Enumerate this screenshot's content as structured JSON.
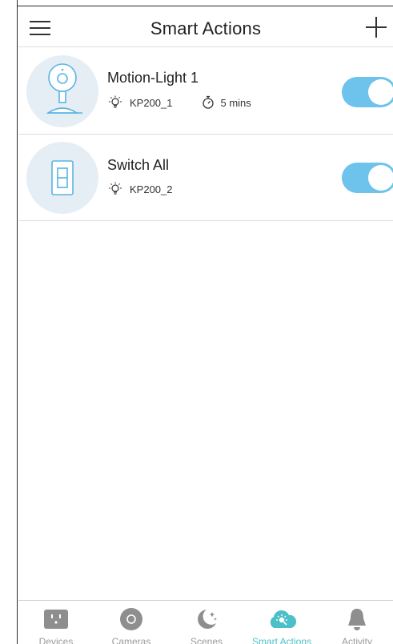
{
  "header": {
    "title": "Smart Actions",
    "menu_icon": "hamburger-menu-icon",
    "add_icon": "plus-icon"
  },
  "actions": [
    {
      "name": "Motion-Light 1",
      "device_icon": "camera-icon",
      "trigger_icon": "light-bulb-icon",
      "device": "KP200_1",
      "timer_icon": "stopwatch-icon",
      "duration": "5 mins",
      "enabled": true
    },
    {
      "name": "Switch All",
      "device_icon": "light-switch-icon",
      "trigger_icon": "light-bulb-icon",
      "device": "KP200_2",
      "enabled": true
    }
  ],
  "tabs": [
    {
      "label": "Devices",
      "icon": "outlet-icon",
      "active": false
    },
    {
      "label": "Cameras",
      "icon": "camera-lens-icon",
      "active": false
    },
    {
      "label": "Scenes",
      "icon": "moon-stars-icon",
      "active": false
    },
    {
      "label": "Smart Actions",
      "icon": "smart-actions-cloud-icon",
      "active": true
    },
    {
      "label": "Activity",
      "icon": "bell-icon",
      "active": false
    }
  ],
  "colors": {
    "toggle_on": "#6dc3ec",
    "accent": "#4cc0c8",
    "inactive_tab": "#9a9a9a",
    "avatar_bg": "#e6eef5",
    "icon_line": "#5ab4e0"
  }
}
